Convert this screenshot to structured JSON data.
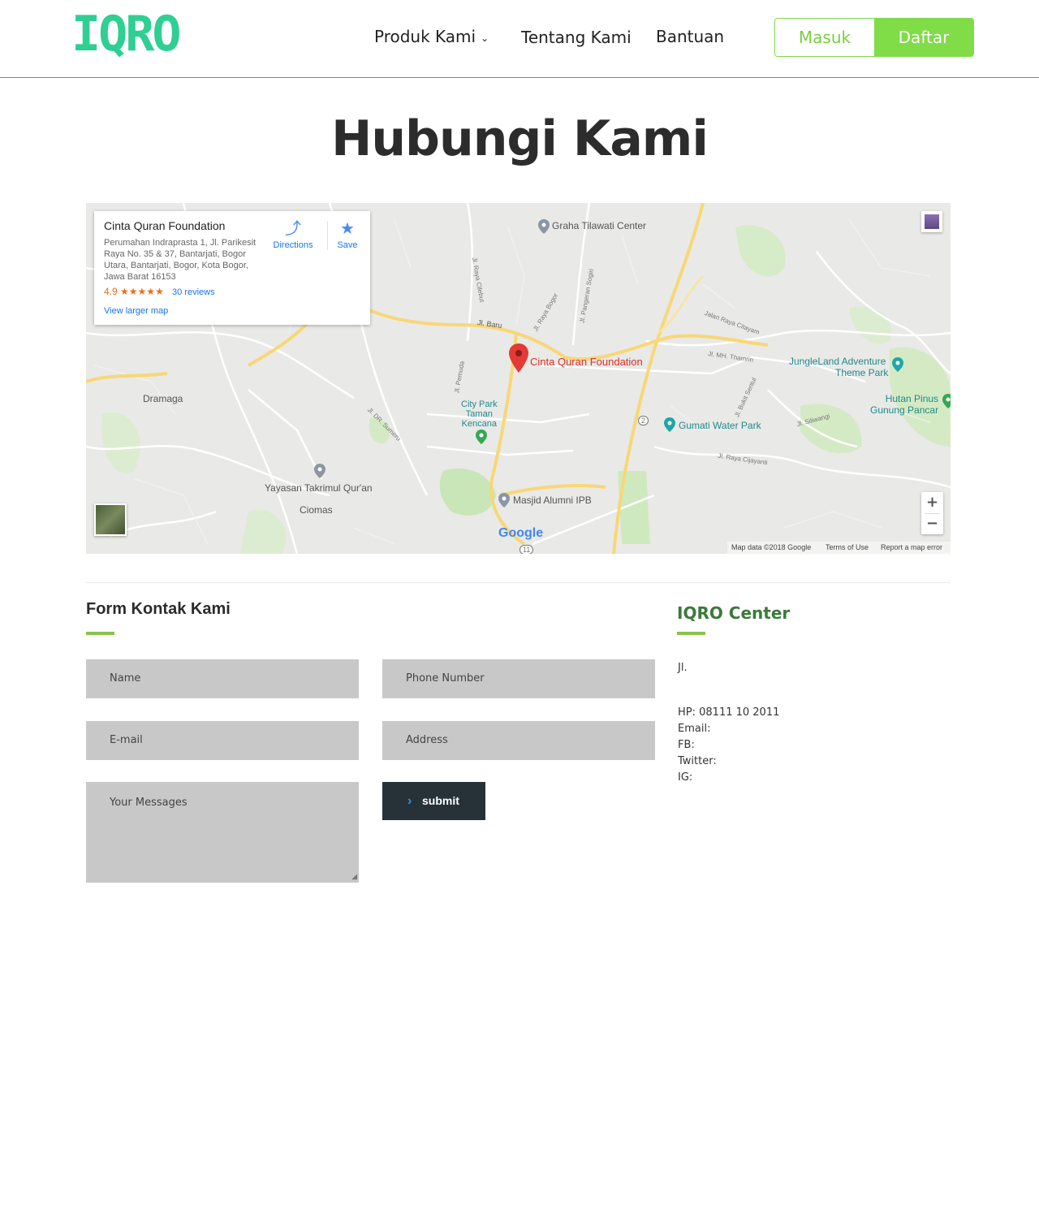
{
  "brand": {
    "logo_text": "IQRO",
    "logo_color": "#2fcf93"
  },
  "nav": {
    "products": "Produk Kami",
    "about": "Tentang Kami",
    "help": "Bantuan"
  },
  "auth": {
    "login": "Masuk",
    "register": "Daftar",
    "accent": "#80dc47"
  },
  "page": {
    "title": "Hubungi Kami"
  },
  "map": {
    "card": {
      "name": "Cinta Quran Foundation",
      "address": "Perumahan Indraprasta 1, Jl. Parikesit Raya No. 35 & 37, Bantarjati, Bogor Utara, Bantarjati, Bogor, Kota Bogor, Jawa Barat 16153",
      "rating": "4.9",
      "stars": "★★★★★",
      "reviews": "30 reviews",
      "larger_map": "View larger map",
      "directions": "Directions",
      "save": "Save"
    },
    "labels": {
      "graha": "Graha Tilawati Center",
      "cqf": "Cinta Quran Foundation",
      "jungleland_1": "JungleLand Adventure",
      "jungleland_2": "Theme Park",
      "hutan_1": "Hutan Pinus",
      "hutan_2": "Gunung Pancar",
      "dramaga": "Dramaga",
      "citypark_1": "City Park",
      "citypark_2": "Taman",
      "citypark_3": "Kencana",
      "gumati": "Gumati Water Park",
      "yayasan": "Yayasan Takrimul Qur'an",
      "ciomas": "Ciomas",
      "masjid": "Masjid Alumni IPB",
      "jl_baru": "Jl. Baru",
      "jl_raya_cilebut": "Jl. Raya Cilebut",
      "jl_raya_bogor": "Jl. Raya Bogor",
      "jl_pangeran": "Jl. Pangeran Sogiri",
      "jl_raya_citayam": "Jalan Raya Citayam",
      "jl_mh_thamrin": "Jl. MH. Thamrin",
      "jl_pemuda": "Jl. Pemuda",
      "jl_dr_sumeru": "Jl. DR. Sumeru",
      "jl_bukit_sentul": "Jl. Bukit Sentul",
      "jl_siliwangi": "Jl. Siliwangi",
      "jl_raya_cijayanti": "Jl. Raya Cijayanti"
    },
    "route_2": "2",
    "route_11": "11",
    "google": "Google",
    "footer": {
      "data": "Map data ©2018 Google",
      "terms": "Terms of Use",
      "report": "Report a map error"
    },
    "zoom_in": "+",
    "zoom_out": "−"
  },
  "form": {
    "title": "Form Kontak Kami",
    "name_placeholder": "Name",
    "phone_placeholder": "Phone Number",
    "email_placeholder": "E-mail",
    "address_placeholder": "Address",
    "message_placeholder": "Your Messages",
    "submit": "submit"
  },
  "center": {
    "title": "IQRO Center",
    "street": "Jl.",
    "hp": "HP: 08111 10 2011",
    "email": "Email:",
    "fb": "FB:",
    "twitter": "Twitter:",
    "ig": "IG:"
  }
}
